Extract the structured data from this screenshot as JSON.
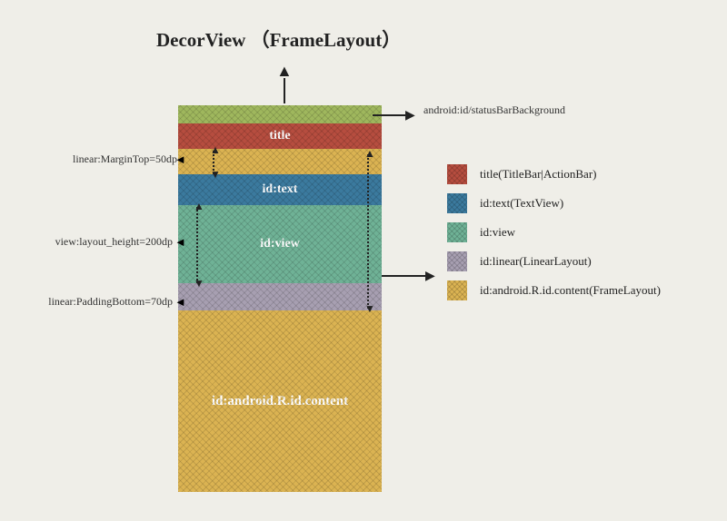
{
  "heading": "DecorView （FrameLayout）",
  "layers": {
    "title_label": "title",
    "text_label": "id:text",
    "view_label": "id:view",
    "content_label": "id:android.R.id.content"
  },
  "annotations": {
    "status_bg": "android:id/statusBarBackground",
    "margin_top": "linear:MarginTop=50dp",
    "layout_height": "view:layout_height=200dp",
    "padding_bottom": "linear:PaddingBottom=70dp"
  },
  "legend": {
    "title": "title(TitleBar|ActionBar)",
    "text": "id:text(TextView)",
    "view": "id:view",
    "linear": "id:linear(LinearLayout)",
    "content": "id:android.R.id.content(FrameLayout)"
  },
  "colors": {
    "status": "#9fb75d",
    "title": "#b64d3f",
    "content_bg": "#dbb352",
    "text": "#3b7a9e",
    "view": "#6fb296",
    "linear": "#a79fb1"
  }
}
